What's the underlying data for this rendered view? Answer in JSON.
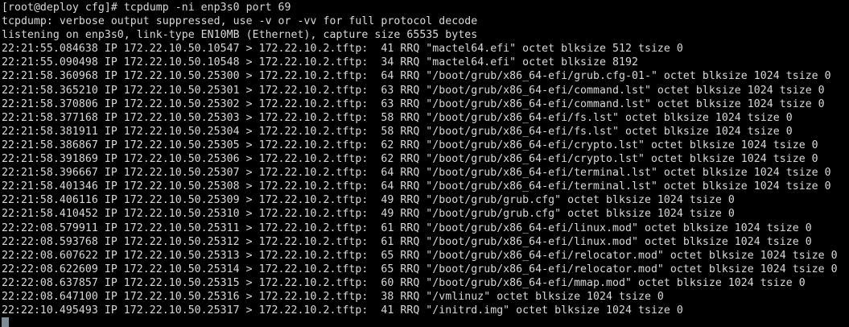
{
  "terminal": {
    "prompt": "[root@deploy cfg]# ",
    "command": "tcpdump -ni enp3s0 port 69",
    "lines": [
      "tcpdump: verbose output suppressed, use -v or -vv for full protocol decode",
      "listening on enp3s0, link-type EN10MB (Ethernet), capture size 65535 bytes",
      "22:21:55.084638 IP 172.22.10.50.10547 > 172.22.10.2.tftp:  41 RRQ \"mactel64.efi\" octet blksize 512 tsize 0",
      "22:21:55.090498 IP 172.22.10.50.10548 > 172.22.10.2.tftp:  34 RRQ \"mactel64.efi\" octet blksize 8192",
      "22:21:58.360968 IP 172.22.10.50.25300 > 172.22.10.2.tftp:  64 RRQ \"/boot/grub/x86_64-efi/grub.cfg-01-\" octet blksize 1024 tsize 0",
      "22:21:58.365210 IP 172.22.10.50.25301 > 172.22.10.2.tftp:  63 RRQ \"/boot/grub/x86_64-efi/command.lst\" octet blksize 1024 tsize 0",
      "22:21:58.370806 IP 172.22.10.50.25302 > 172.22.10.2.tftp:  63 RRQ \"/boot/grub/x86_64-efi/command.lst\" octet blksize 1024 tsize 0",
      "22:21:58.377168 IP 172.22.10.50.25303 > 172.22.10.2.tftp:  58 RRQ \"/boot/grub/x86_64-efi/fs.lst\" octet blksize 1024 tsize 0",
      "22:21:58.381911 IP 172.22.10.50.25304 > 172.22.10.2.tftp:  58 RRQ \"/boot/grub/x86_64-efi/fs.lst\" octet blksize 1024 tsize 0",
      "22:21:58.386867 IP 172.22.10.50.25305 > 172.22.10.2.tftp:  62 RRQ \"/boot/grub/x86_64-efi/crypto.lst\" octet blksize 1024 tsize 0",
      "22:21:58.391869 IP 172.22.10.50.25306 > 172.22.10.2.tftp:  62 RRQ \"/boot/grub/x86_64-efi/crypto.lst\" octet blksize 1024 tsize 0",
      "22:21:58.396667 IP 172.22.10.50.25307 > 172.22.10.2.tftp:  64 RRQ \"/boot/grub/x86_64-efi/terminal.lst\" octet blksize 1024 tsize 0",
      "22:21:58.401346 IP 172.22.10.50.25308 > 172.22.10.2.tftp:  64 RRQ \"/boot/grub/x86_64-efi/terminal.lst\" octet blksize 1024 tsize 0",
      "22:21:58.406116 IP 172.22.10.50.25309 > 172.22.10.2.tftp:  49 RRQ \"/boot/grub/grub.cfg\" octet blksize 1024 tsize 0",
      "22:21:58.410452 IP 172.22.10.50.25310 > 172.22.10.2.tftp:  49 RRQ \"/boot/grub/grub.cfg\" octet blksize 1024 tsize 0",
      "22:22:08.579911 IP 172.22.10.50.25311 > 172.22.10.2.tftp:  61 RRQ \"/boot/grub/x86_64-efi/linux.mod\" octet blksize 1024 tsize 0",
      "22:22:08.593768 IP 172.22.10.50.25312 > 172.22.10.2.tftp:  61 RRQ \"/boot/grub/x86_64-efi/linux.mod\" octet blksize 1024 tsize 0",
      "22:22:08.607622 IP 172.22.10.50.25313 > 172.22.10.2.tftp:  65 RRQ \"/boot/grub/x86_64-efi/relocator.mod\" octet blksize 1024 tsize 0",
      "22:22:08.622609 IP 172.22.10.50.25314 > 172.22.10.2.tftp:  65 RRQ \"/boot/grub/x86_64-efi/relocator.mod\" octet blksize 1024 tsize 0",
      "22:22:08.637857 IP 172.22.10.50.25315 > 172.22.10.2.tftp:  60 RRQ \"/boot/grub/x86_64-efi/mmap.mod\" octet blksize 1024 tsize 0",
      "22:22:08.647100 IP 172.22.10.50.25316 > 172.22.10.2.tftp:  38 RRQ \"/vmlinuz\" octet blksize 1024 tsize 0",
      "22:22:10.495493 IP 172.22.10.50.25317 > 172.22.10.2.tftp:  41 RRQ \"/initrd.img\" octet blksize 1024 tsize 0"
    ],
    "colors": {
      "background": "#000000",
      "foreground": "#d9d9d9",
      "cursor": "#7f8c94"
    }
  }
}
